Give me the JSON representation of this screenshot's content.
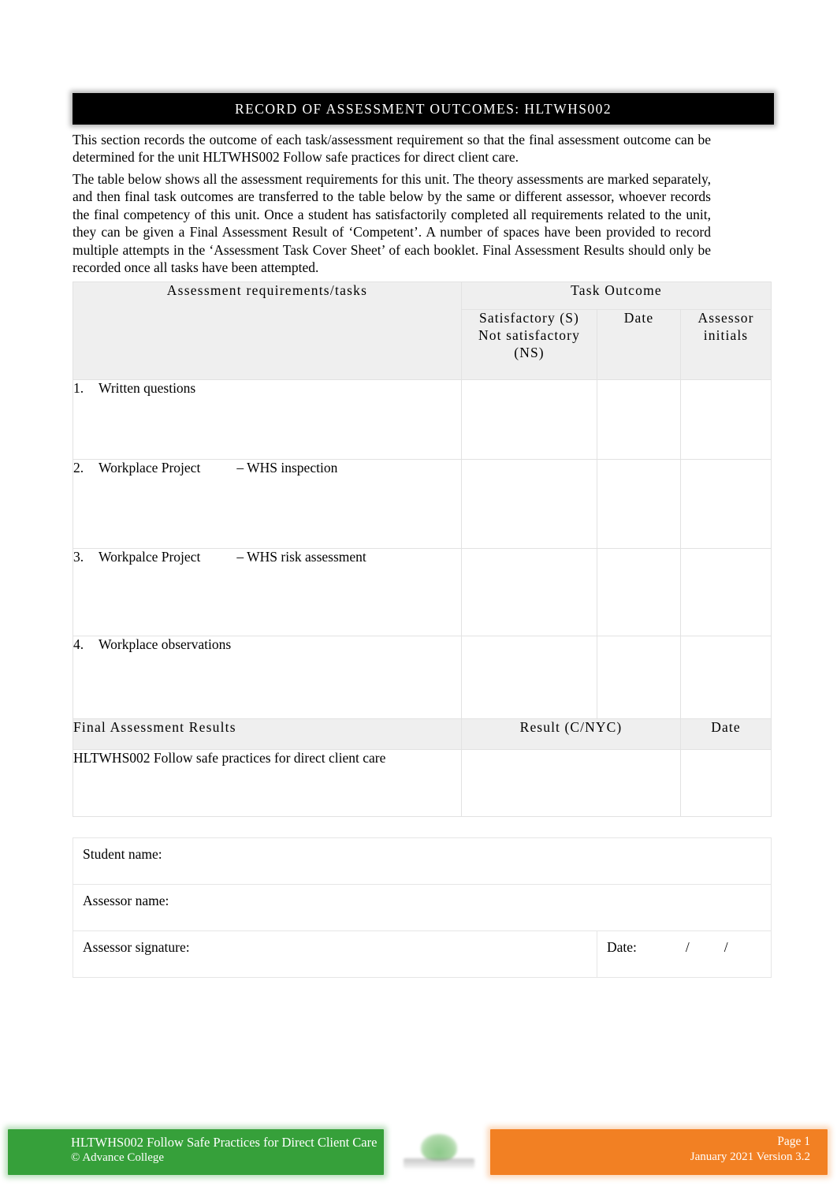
{
  "document": {
    "banner_title": "RECORD OF ASSESSMENT OUTCOMES: HLTWHS002",
    "paragraph_1": "This section records the outcome of each task/assessment requirement so that the final assessment outcome can be determined for the unit HLTWHS002 Follow safe practices for direct client care.",
    "paragraph_2": "The table below shows all the assessment requirements for this unit. The theory assessments are marked separately, and then final task outcomes are transferred to the table below by the same or different assessor, whoever records the final competency of this unit. Once a student has satisfactorily completed all requirements related to the unit, they can be given a Final Assessment Result of ‘Competent’. A number of spaces have been provided to record multiple attempts in the ‘Assessment Task Cover Sheet’ of each booklet. Final Assessment Results should only be recorded once all tasks have been attempted."
  },
  "table": {
    "headers": {
      "requirements": "Assessment requirements/tasks",
      "task_outcome": "Task Outcome",
      "satisfactory": "Satisfactory (S)",
      "not_satisfactory": "Not satisfactory",
      "ns_abbrev": "(NS)",
      "date": "Date",
      "assessor_initials_line1": "Assessor",
      "assessor_initials_line2": "initials"
    },
    "rows": [
      {
        "number": "1.",
        "title": "Written questions",
        "suffix": "",
        "outcome": "",
        "date": "",
        "initials": ""
      },
      {
        "number": "2.",
        "title": "Workplace Project",
        "suffix": "–  WHS inspection",
        "outcome": "",
        "date": "",
        "initials": ""
      },
      {
        "number": "3.",
        "title": "Workpalce Project",
        "suffix": "–  WHS risk assessment",
        "outcome": "",
        "date": "",
        "initials": ""
      },
      {
        "number": "4.",
        "title": "Workplace observations",
        "suffix": "",
        "outcome": "",
        "date": "",
        "initials": ""
      }
    ]
  },
  "final_assessment": {
    "section_label": "Final Assessment Results",
    "result_header": "Result (C/NYC)",
    "date_header": "Date",
    "unit_label": "HLTWHS002 Follow safe practices for direct client care",
    "result_value": "",
    "date_value": ""
  },
  "signature_block": {
    "student_name_label": "Student name:",
    "student_name_value": "",
    "assessor_name_label": "Assessor name:",
    "assessor_name_value": "",
    "assessor_signature_label": "Assessor signature:",
    "assessor_signature_value": "",
    "date_label": "Date:",
    "slash_1": "/",
    "slash_2": "/"
  },
  "footer": {
    "left_line_1": "HLTWHS002 Follow Safe Practices for Direct Client Care",
    "left_line_2": "© Advance College",
    "right_line_1": "Page 1",
    "right_line_2": "January 2021 Version 3.2",
    "colors": {
      "green": "#36a03a",
      "orange": "#f28023",
      "banner_black": "#000000",
      "table_header_gray": "#efefef"
    }
  }
}
